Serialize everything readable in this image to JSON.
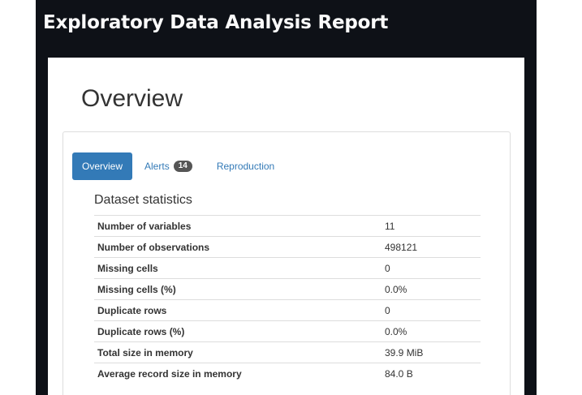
{
  "header": {
    "title": "Exploratory Data Analysis Report"
  },
  "report": {
    "section_title": "Overview",
    "tabs": [
      {
        "label": "Overview",
        "active": true
      },
      {
        "label": "Alerts",
        "badge": "14",
        "active": false
      },
      {
        "label": "Reproduction",
        "active": false
      }
    ],
    "dataset_statistics": {
      "title": "Dataset statistics",
      "rows": [
        {
          "label": "Number of variables",
          "value": "11"
        },
        {
          "label": "Number of observations",
          "value": "498121"
        },
        {
          "label": "Missing cells",
          "value": "0"
        },
        {
          "label": "Missing cells (%)",
          "value": "0.0%"
        },
        {
          "label": "Duplicate rows",
          "value": "0"
        },
        {
          "label": "Duplicate rows (%)",
          "value": "0.0%"
        },
        {
          "label": "Total size in memory",
          "value": "39.9 MiB"
        },
        {
          "label": "Average record size in memory",
          "value": "84.0 B"
        }
      ]
    }
  },
  "colors": {
    "app_background": "#0e1117",
    "accent": "#337ab7",
    "badge": "#555555"
  }
}
